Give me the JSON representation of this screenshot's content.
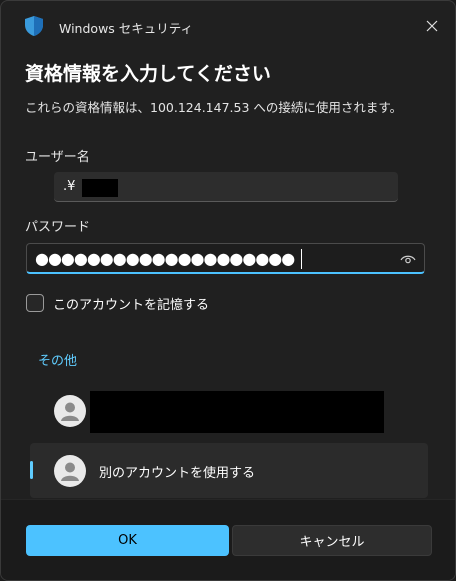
{
  "window": {
    "app_title": "Windows セキュリティ",
    "app_icon": "shield-icon",
    "close_icon": "close-icon"
  },
  "dialog": {
    "heading": "資格情報を入力してください",
    "subtext": "これらの資格情報は、100.124.147.53 への接続に使用されます。"
  },
  "username": {
    "label": "ユーザー名",
    "value_prefix": ".¥"
  },
  "password": {
    "label": "パスワード",
    "masked_value": "●●●●●●●●●●●●●●●●●●●●",
    "reveal_icon": "eye-icon"
  },
  "remember": {
    "label": "このアカウントを記憶する",
    "checked": false
  },
  "other": {
    "label": "その他",
    "accounts": [
      {
        "icon": "user-avatar-icon"
      },
      {
        "icon": "user-avatar-icon",
        "label": "別のアカウントを使用する",
        "selected": true
      }
    ]
  },
  "buttons": {
    "ok": "OK",
    "cancel": "キャンセル"
  },
  "colors": {
    "accent": "#4cc2ff",
    "link": "#60cdff",
    "background": "#202020"
  }
}
